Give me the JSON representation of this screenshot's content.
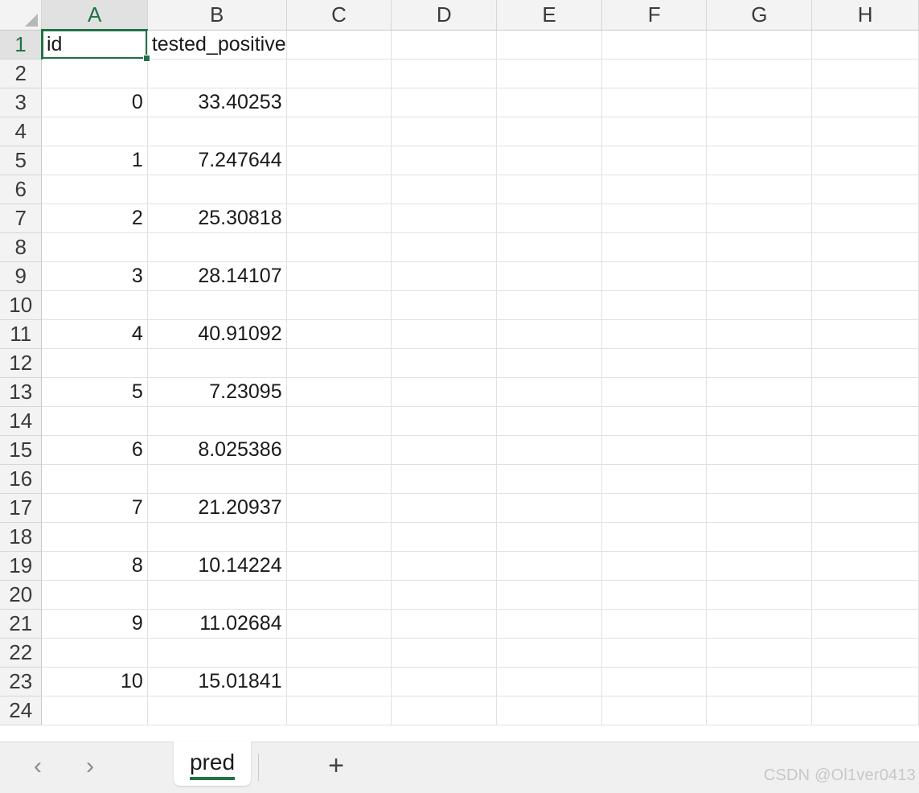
{
  "columns": [
    "A",
    "B",
    "C",
    "D",
    "E",
    "F",
    "G",
    "H"
  ],
  "selected_column": "A",
  "selected_row": "1",
  "rows": [
    {
      "num": "1",
      "a": "id",
      "b": "tested_positive"
    },
    {
      "num": "2",
      "a": "",
      "b": ""
    },
    {
      "num": "3",
      "a": "0",
      "b": "33.40253"
    },
    {
      "num": "4",
      "a": "",
      "b": ""
    },
    {
      "num": "5",
      "a": "1",
      "b": "7.247644"
    },
    {
      "num": "6",
      "a": "",
      "b": ""
    },
    {
      "num": "7",
      "a": "2",
      "b": "25.30818"
    },
    {
      "num": "8",
      "a": "",
      "b": ""
    },
    {
      "num": "9",
      "a": "3",
      "b": "28.14107"
    },
    {
      "num": "10",
      "a": "",
      "b": ""
    },
    {
      "num": "11",
      "a": "4",
      "b": "40.91092"
    },
    {
      "num": "12",
      "a": "",
      "b": ""
    },
    {
      "num": "13",
      "a": "5",
      "b": "7.23095"
    },
    {
      "num": "14",
      "a": "",
      "b": ""
    },
    {
      "num": "15",
      "a": "6",
      "b": "8.025386"
    },
    {
      "num": "16",
      "a": "",
      "b": ""
    },
    {
      "num": "17",
      "a": "7",
      "b": "21.20937"
    },
    {
      "num": "18",
      "a": "",
      "b": ""
    },
    {
      "num": "19",
      "a": "8",
      "b": "10.14224"
    },
    {
      "num": "20",
      "a": "",
      "b": ""
    },
    {
      "num": "21",
      "a": "9",
      "b": "11.02684"
    },
    {
      "num": "22",
      "a": "",
      "b": ""
    },
    {
      "num": "23",
      "a": "10",
      "b": "15.01841"
    },
    {
      "num": "24",
      "a": "",
      "b": ""
    }
  ],
  "tabbar": {
    "prev_icon": "‹",
    "next_icon": "›",
    "sheet_name": "pred",
    "add_icon": "+",
    "watermark": "CSDN @Ol1ver0413"
  },
  "colors": {
    "accent": "#217346",
    "header_bg": "#f3f3f3",
    "grid_line": "#e1e1e1"
  }
}
